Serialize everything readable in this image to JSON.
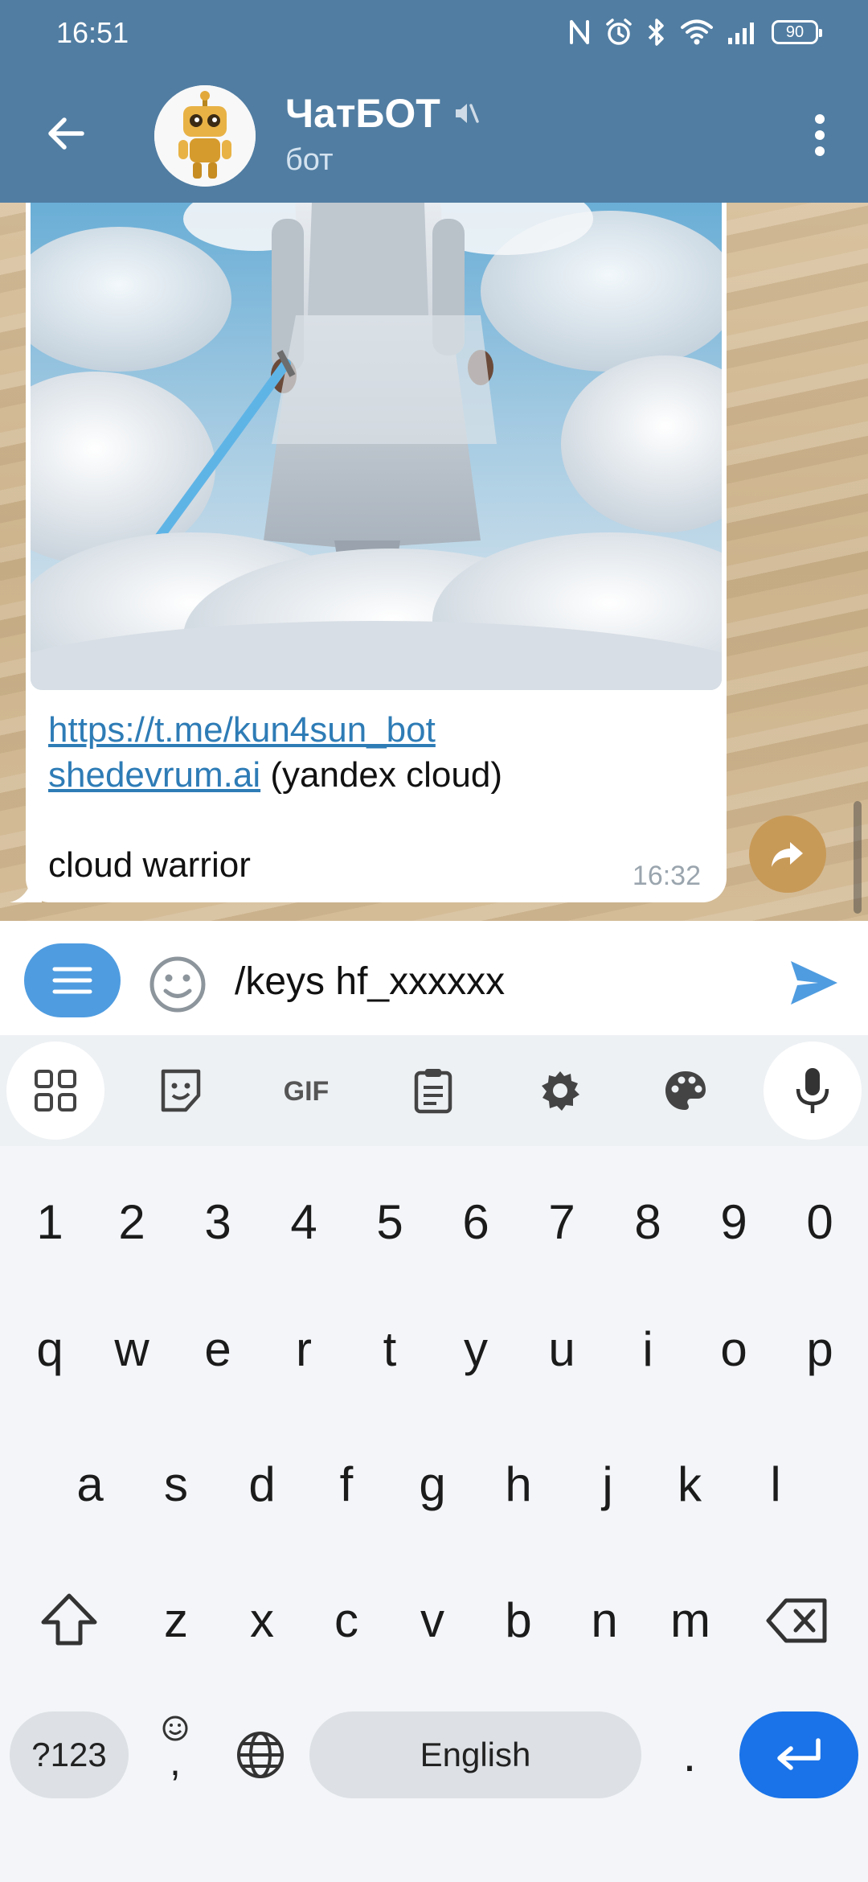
{
  "status_bar": {
    "time": "16:51",
    "battery": "90"
  },
  "header": {
    "title": "ЧатБОТ",
    "subtitle": "бот"
  },
  "message": {
    "link1": "https://t.me/kun4sun_bot",
    "link2": "shedevrum.ai",
    "text2": " (yandex cloud)",
    "caption": "cloud warrior",
    "time": "16:32"
  },
  "input": {
    "value": "/keys hf_xxxxxx"
  },
  "keyboard": {
    "row_numbers": [
      "1",
      "2",
      "3",
      "4",
      "5",
      "6",
      "7",
      "8",
      "9",
      "0"
    ],
    "row1": [
      "q",
      "w",
      "e",
      "r",
      "t",
      "y",
      "u",
      "i",
      "o",
      "p"
    ],
    "row2": [
      "a",
      "s",
      "d",
      "f",
      "g",
      "h",
      "j",
      "k",
      "l"
    ],
    "row3": [
      "z",
      "x",
      "c",
      "v",
      "b",
      "n",
      "m"
    ],
    "symbols_label": "?123",
    "comma": ",",
    "space_label": "English",
    "period": "."
  },
  "toolbar_icons": [
    "apps-icon",
    "sticker-icon",
    "gif-icon",
    "clipboard-icon",
    "settings-icon",
    "palette-icon",
    "mic-icon"
  ],
  "colors": {
    "header": "#517da2",
    "accent": "#4f9ce0",
    "link": "#2e7cb6",
    "enter": "#1a73e8"
  }
}
